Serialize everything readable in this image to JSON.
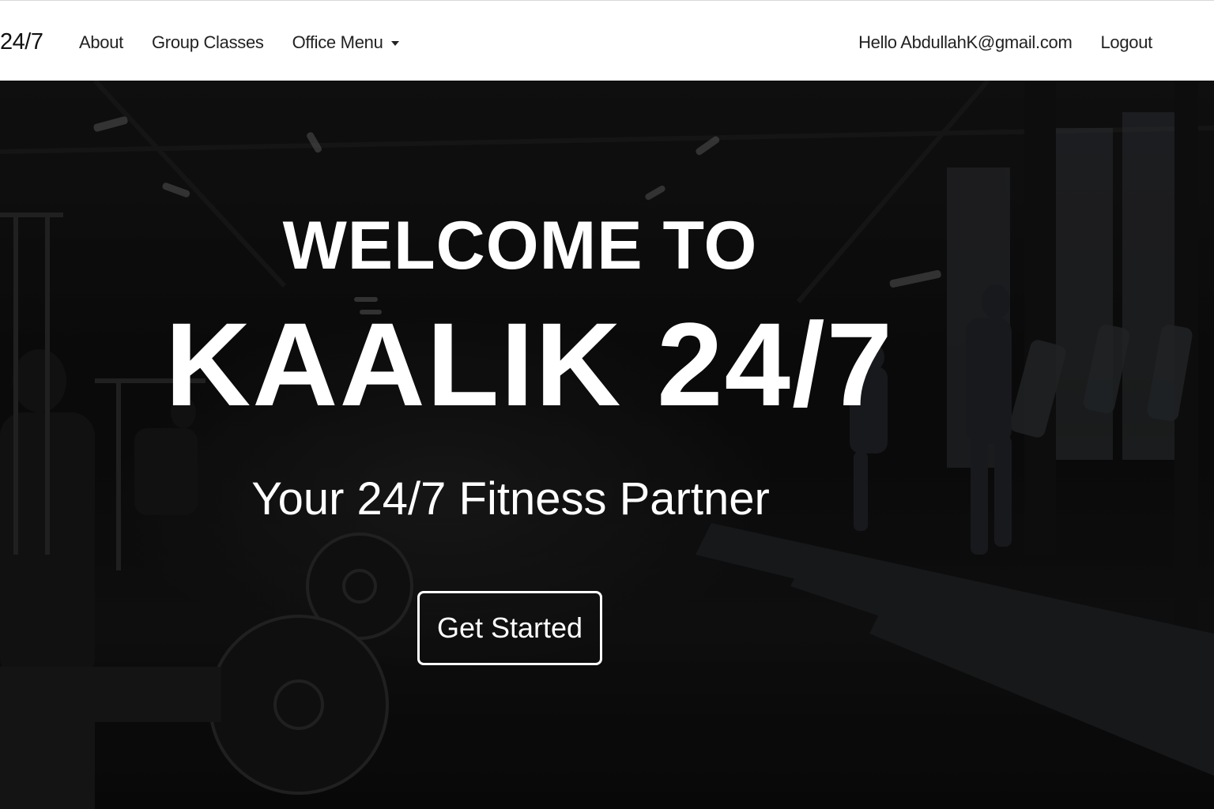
{
  "nav": {
    "brand": "24/7",
    "links": [
      {
        "label": "About"
      },
      {
        "label": "Group Classes"
      },
      {
        "label": "Office Menu"
      }
    ],
    "user_greeting": "Hello AbdullahK@gmail.com",
    "logout_label": "Logout"
  },
  "hero": {
    "title_line1": "WELCOME TO",
    "title_line2": "KAALIK 24/7",
    "subtitle": "Your 24/7 Fitness Partner",
    "cta_label": "Get Started"
  },
  "colors": {
    "navbar_bg": "#ffffff",
    "hero_bg": "#0d0d0d",
    "hero_text": "#ffffff",
    "nav_text": "#222222"
  },
  "icons": {
    "dropdown": "caret-down-icon"
  }
}
